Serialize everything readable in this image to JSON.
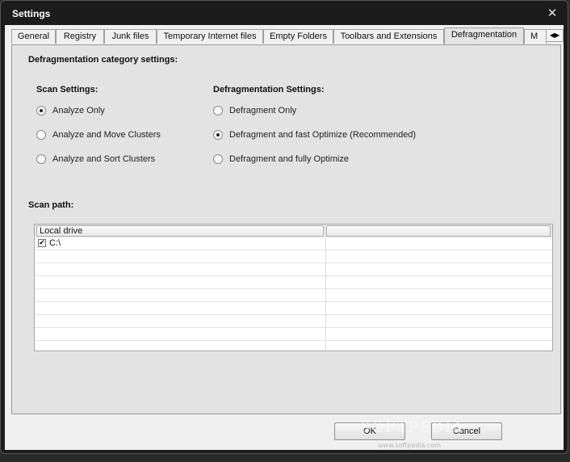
{
  "window": {
    "title": "Settings",
    "close_glyph": "✕"
  },
  "tabs": [
    {
      "label": "General"
    },
    {
      "label": "Registry"
    },
    {
      "label": "Junk files"
    },
    {
      "label": "Temporary Internet files"
    },
    {
      "label": "Empty Folders"
    },
    {
      "label": "Toolbars and Extensions"
    },
    {
      "label": "Defragmentation",
      "active": true
    },
    {
      "label": "M"
    }
  ],
  "tab_scroll": {
    "left": "◀",
    "right": "▶"
  },
  "panel": {
    "heading": "Defragmentation category settings:",
    "scan_settings": {
      "title": "Scan Settings:",
      "options": [
        {
          "label": "Analyze Only",
          "selected": true
        },
        {
          "label": "Analyze and Move Clusters",
          "selected": false
        },
        {
          "label": "Analyze and Sort Clusters",
          "selected": false
        }
      ]
    },
    "defrag_settings": {
      "title": "Defragmentation Settings:",
      "options": [
        {
          "label": "Defragment Only",
          "selected": false
        },
        {
          "label": "Defragment and fast Optimize (Recommended)",
          "selected": true
        },
        {
          "label": "Defragment and fully Optimize",
          "selected": false
        }
      ]
    },
    "scan_path": {
      "title": "Scan path:",
      "columns": [
        "Local drive",
        ""
      ],
      "rows": [
        {
          "checked": true,
          "check_glyph": "✔",
          "drive": "C:\\"
        }
      ]
    }
  },
  "buttons": {
    "ok": "OK",
    "cancel": "Cancel"
  },
  "watermark": {
    "main": "SOFTPEDIA",
    "sub": "www.softpedia.com"
  }
}
